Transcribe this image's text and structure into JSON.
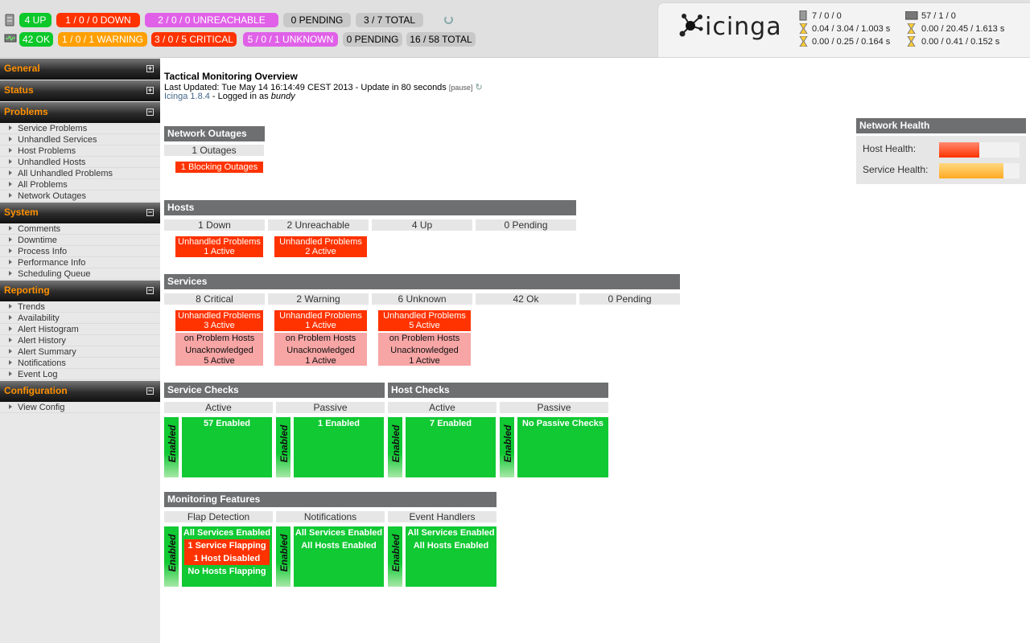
{
  "top": {
    "host_up": "4 UP",
    "host_down_a": "1",
    "host_down_b": "0",
    "host_down_c": "0 DOWN",
    "host_unr_a": "2",
    "host_unr_b": "0",
    "host_unr_c": "0 UNREACHABLE",
    "host_pending": "0 PENDING",
    "host_total": "3 / 7 TOTAL",
    "svc_ok": "42 OK",
    "svc_warn_a": "1",
    "svc_warn_b": "0",
    "svc_warn_c": "1 WARNING",
    "svc_crit_a": "3",
    "svc_crit_b": "0",
    "svc_crit_c": "5 CRITICAL",
    "svc_unk_a": "5",
    "svc_unk_b": "0",
    "svc_unk_c": "1 UNKNOWN",
    "svc_pending": "0 PENDING",
    "svc_total": "16 / 58 TOTAL"
  },
  "logo": {
    "text": "icinga"
  },
  "perf": {
    "h_counts": "7 / 0 / 0",
    "h_lat": "0.04 / 3.04 / 1.003 s",
    "h_exec": "0.00 / 0.25 / 0.164 s",
    "s_counts": "57 / 1 / 0",
    "s_lat": "0.00 / 20.45 / 1.613 s",
    "s_exec": "0.00 / 0.41 / 0.152 s"
  },
  "sidebar": {
    "general": "General",
    "status": "Status",
    "problems": "Problems",
    "system": "System",
    "reporting": "Reporting",
    "configuration": "Configuration",
    "problems_items": [
      "Service Problems",
      "Unhandled Services",
      "Host Problems",
      "Unhandled Hosts",
      "All Unhandled Problems",
      "All Problems",
      "Network Outages"
    ],
    "system_items": [
      "Comments",
      "Downtime",
      "Process Info",
      "Performance Info",
      "Scheduling Queue"
    ],
    "reporting_items": [
      "Trends",
      "Availability",
      "Alert Histogram",
      "Alert History",
      "Alert Summary",
      "Notifications",
      "Event Log"
    ],
    "config_items": [
      "View Config"
    ],
    "plus": "+",
    "minus": "−"
  },
  "header": {
    "title": "Tactical Monitoring Overview",
    "updated": "Last Updated: Tue May 14 16:14:49 CEST 2013 - Update in 80 seconds",
    "pause": "[pause]",
    "version": "Icinga 1.8.4",
    "logged": " - Logged in as ",
    "user": "bundy"
  },
  "outages": {
    "title": "Network Outages",
    "count": "1 Outages",
    "blocking": "1 Blocking Outages"
  },
  "hosts": {
    "title": "Hosts",
    "cols": [
      "1 Down",
      "2 Unreachable",
      "4 Up",
      "0 Pending"
    ],
    "down_p": [
      "Unhandled Problems",
      "1 Active"
    ],
    "unr_p": [
      "Unhandled Problems",
      "2 Active"
    ]
  },
  "services": {
    "title": "Services",
    "cols": [
      "8 Critical",
      "2 Warning",
      "6 Unknown",
      "42 Ok",
      "0 Pending"
    ],
    "crit": [
      "Unhandled Problems",
      "3 Active",
      "on Problem Hosts",
      "Unacknowledged",
      "5 Active"
    ],
    "warn": [
      "Unhandled Problems",
      "1 Active",
      "on Problem Hosts",
      "Unacknowledged",
      "1 Active"
    ],
    "unk": [
      "Unhandled Problems",
      "5 Active",
      "on Problem Hosts",
      "Unacknowledged",
      "1 Active"
    ]
  },
  "checks": {
    "svc_title": "Service Checks",
    "host_title": "Host Checks",
    "active": "Active",
    "passive": "Passive",
    "enabled": "Enabled",
    "svc_active": "57 Enabled",
    "svc_passive": "1 Enabled",
    "host_active": "7 Enabled",
    "host_passive": "No Passive Checks"
  },
  "features": {
    "title": "Monitoring Features",
    "flap": "Flap Detection",
    "notif": "Notifications",
    "events": "Event Handlers",
    "enabled": "Enabled",
    "flap_items": [
      "All Services Enabled",
      "1 Service Flapping",
      "1 Host Disabled",
      "No Hosts Flapping"
    ],
    "notif_items": [
      "All Services Enabled",
      "All Hosts Enabled"
    ],
    "event_items": [
      "All Services Enabled",
      "All Hosts Enabled"
    ]
  },
  "health": {
    "title": "Network Health",
    "host": "Host Health:",
    "service": "Service Health:",
    "host_level": 0.5,
    "service_level": 0.8,
    "host_color": "#ff5533",
    "service_color": "#ffbb33"
  }
}
